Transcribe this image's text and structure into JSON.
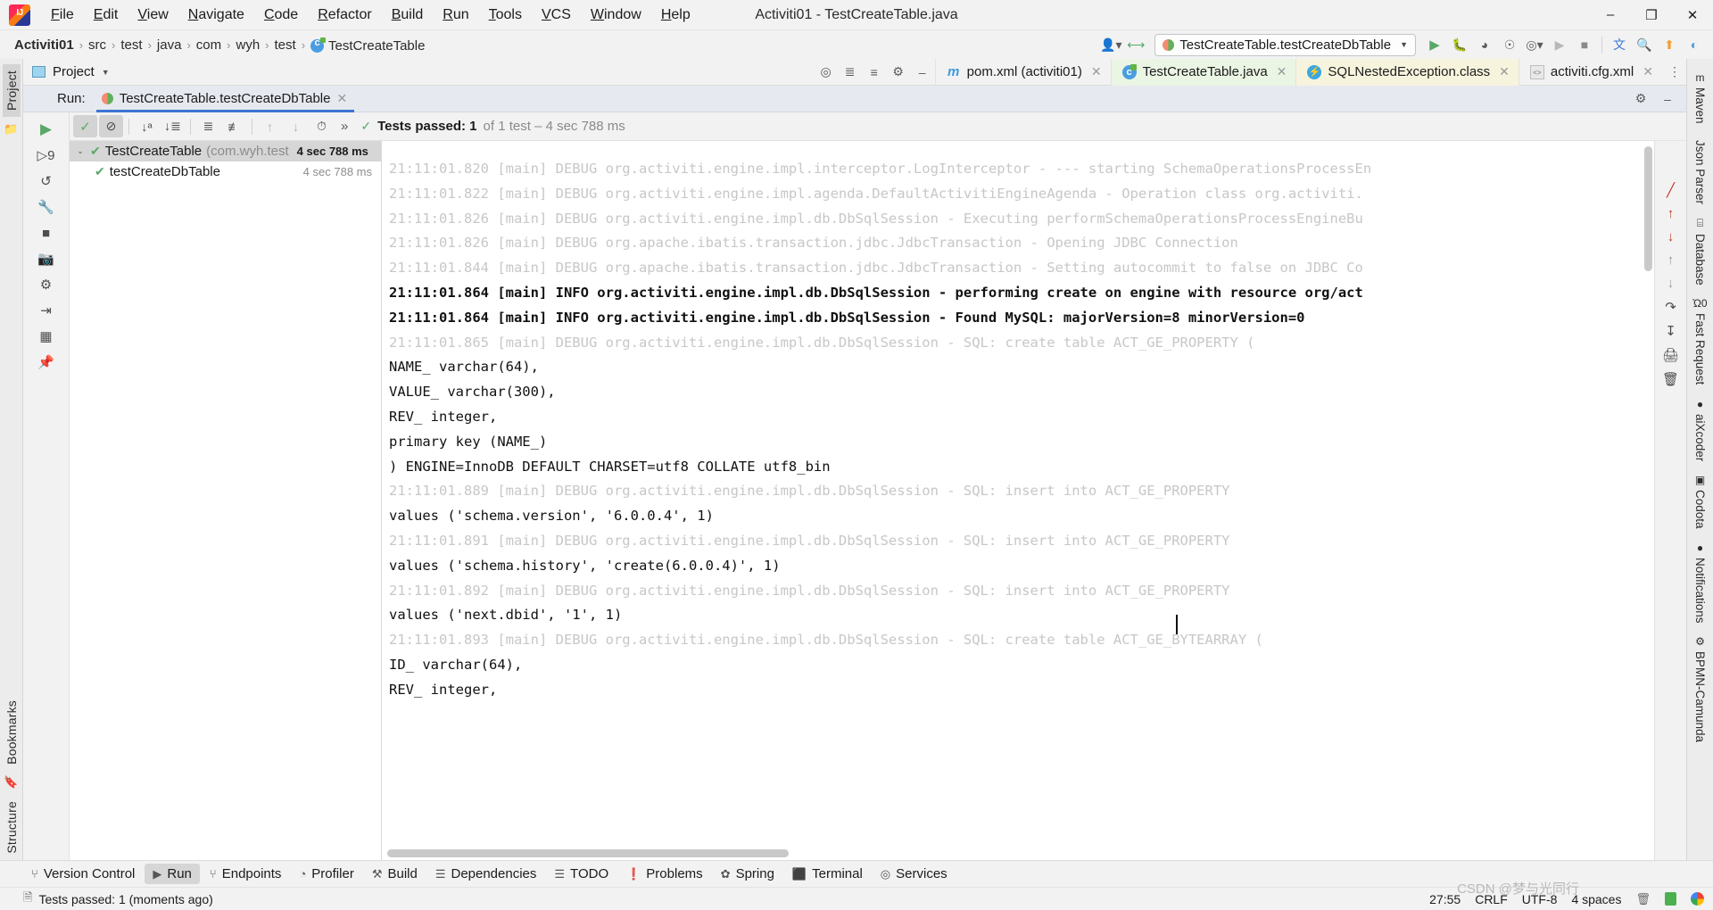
{
  "titlebar": {
    "window_title": "Activiti01 - TestCreateTable.java",
    "menus": [
      "File",
      "Edit",
      "View",
      "Navigate",
      "Code",
      "Refactor",
      "Build",
      "Run",
      "Tools",
      "VCS",
      "Window",
      "Help"
    ],
    "minimize": "–",
    "maximize": "❐",
    "close": "✕"
  },
  "navbar": {
    "crumbs": [
      "Activiti01",
      "src",
      "test",
      "java",
      "com",
      "wyh",
      "test",
      "TestCreateTable"
    ],
    "separator": "›",
    "run_config": "TestCreateTable.testCreateDbTable",
    "caret": "▼"
  },
  "left_strip": {
    "project_label": "Project",
    "structure_label": "Structure",
    "bookmarks_label": "Bookmarks"
  },
  "project_header": {
    "title": "Project",
    "caret": "▼"
  },
  "editor_tabs": [
    {
      "label": "pom.xml (activiti01)",
      "icon": "maven-icon",
      "style": "plain"
    },
    {
      "label": "TestCreateTable.java",
      "icon": "java-class-icon",
      "style": "green"
    },
    {
      "label": "SQLNestedException.class",
      "icon": "class-file-icon",
      "style": "yellow"
    },
    {
      "label": "activiti.cfg.xml",
      "icon": "xml-file-icon",
      "style": "plain"
    }
  ],
  "run_panel": {
    "run_label": "Run:",
    "tab_title": "TestCreateTable.testCreateDbTable",
    "status_text": "Tests passed: 1",
    "status_suffix": " of 1 test – 4 sec 788 ms",
    "status_detail_bold": "Tests passed: 1",
    "more_button": "»"
  },
  "test_tree": [
    {
      "name": "TestCreateTable",
      "package": "(com.wyh.test",
      "time": "4 sec 788 ms",
      "selected": true,
      "level": 0
    },
    {
      "name": "testCreateDbTable",
      "package": "",
      "time": "4 sec 788 ms",
      "selected": false,
      "level": 1
    }
  ],
  "console_lines": [
    {
      "type": "debug",
      "text": "21:11:01.820 [main] DEBUG org.activiti.engine.impl.interceptor.LogInterceptor - --- starting SchemaOperationsProcessEn"
    },
    {
      "type": "debug",
      "text": "21:11:01.822 [main] DEBUG org.activiti.engine.impl.agenda.DefaultActivitiEngineAgenda - Operation class org.activiti."
    },
    {
      "type": "debug",
      "text": "21:11:01.826 [main] DEBUG org.activiti.engine.impl.db.DbSqlSession - Executing performSchemaOperationsProcessEngineBu"
    },
    {
      "type": "debug",
      "text": "21:11:01.826 [main] DEBUG org.apache.ibatis.transaction.jdbc.JdbcTransaction - Opening JDBC Connection"
    },
    {
      "type": "debug",
      "text": "21:11:01.844 [main] DEBUG org.apache.ibatis.transaction.jdbc.JdbcTransaction - Setting autocommit to false on JDBC Co"
    },
    {
      "type": "info",
      "text": "21:11:01.864 [main] INFO org.activiti.engine.impl.db.DbSqlSession - performing create on engine with resource org/act"
    },
    {
      "type": "info",
      "text": "21:11:01.864 [main] INFO org.activiti.engine.impl.db.DbSqlSession - Found MySQL: majorVersion=8 minorVersion=0"
    },
    {
      "type": "debug",
      "text": "21:11:01.865 [main] DEBUG org.activiti.engine.impl.db.DbSqlSession - SQL: create table ACT_GE_PROPERTY ("
    },
    {
      "type": "sql",
      "text": "NAME_ varchar(64),"
    },
    {
      "type": "sql",
      "text": "VALUE_ varchar(300),"
    },
    {
      "type": "sql",
      "text": "REV_ integer,"
    },
    {
      "type": "sql",
      "text": "primary key (NAME_)"
    },
    {
      "type": "sql",
      "text": ") ENGINE=InnoDB DEFAULT CHARSET=utf8 COLLATE utf8_bin"
    },
    {
      "type": "debug",
      "text": "21:11:01.889 [main] DEBUG org.activiti.engine.impl.db.DbSqlSession - SQL: insert into ACT_GE_PROPERTY"
    },
    {
      "type": "sql",
      "text": "values ('schema.version', '6.0.0.4', 1)"
    },
    {
      "type": "debug",
      "text": "21:11:01.891 [main] DEBUG org.activiti.engine.impl.db.DbSqlSession - SQL: insert into ACT_GE_PROPERTY"
    },
    {
      "type": "sql",
      "text": "values ('schema.history', 'create(6.0.0.4)', 1)"
    },
    {
      "type": "debug",
      "text": "21:11:01.892 [main] DEBUG org.activiti.engine.impl.db.DbSqlSession - SQL: insert into ACT_GE_PROPERTY"
    },
    {
      "type": "sql",
      "text": "values ('next.dbid', '1', 1)"
    },
    {
      "type": "debug",
      "text": "21:11:01.893 [main] DEBUG org.activiti.engine.impl.db.DbSqlSession - SQL: create table ACT_GE_BYTEARRAY ("
    },
    {
      "type": "sql",
      "text": "ID_ varchar(64),"
    },
    {
      "type": "sql",
      "text": "REV_ integer,"
    }
  ],
  "right_strip": [
    {
      "label": "Maven",
      "icon": "m"
    },
    {
      "label": "Json Parser",
      "icon": ""
    },
    {
      "label": "Database",
      "icon": "⌸"
    },
    {
      "label": "Fast Request",
      "icon": "Ὠ0"
    },
    {
      "label": "aiXcoder",
      "icon": "●"
    },
    {
      "label": "Codota",
      "icon": "▣"
    },
    {
      "label": "Notifications",
      "icon": "●"
    },
    {
      "label": "BPMN-Camunda",
      "icon": "⚙"
    }
  ],
  "bottom_toolwindows": [
    {
      "label": "Version Control",
      "icon": "⑂",
      "active": false
    },
    {
      "label": "Run",
      "icon": "▶",
      "active": true
    },
    {
      "label": "Endpoints",
      "icon": "⑂",
      "active": false
    },
    {
      "label": "Profiler",
      "icon": "◔",
      "active": false
    },
    {
      "label": "Build",
      "icon": "⚒",
      "active": false
    },
    {
      "label": "Dependencies",
      "icon": "☰",
      "active": false
    },
    {
      "label": "TODO",
      "icon": "☰",
      "active": false
    },
    {
      "label": "Problems",
      "icon": "❗",
      "active": false
    },
    {
      "label": "Spring",
      "icon": "✿",
      "active": false
    },
    {
      "label": "Terminal",
      "icon": "⬛",
      "active": false
    },
    {
      "label": "Services",
      "icon": "◎",
      "active": false
    }
  ],
  "statusbar": {
    "message": "Tests passed: 1 (moments ago)",
    "caret_position": "27:55",
    "line_separator": "CRLF",
    "encoding": "UTF-8",
    "indent": "4 spaces",
    "watermark": "CSDN @梦与光同行"
  },
  "colors": {
    "accent_blue": "#3c75d4",
    "success_green": "#59a869",
    "tab_green": "#eaf5e4",
    "tab_yellow": "#f7f4dd",
    "debug_text": "#c7c7c7"
  }
}
